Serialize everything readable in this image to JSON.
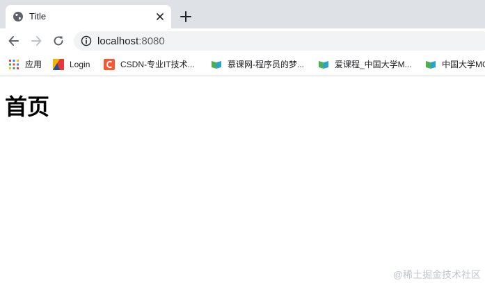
{
  "tab": {
    "title": "Title"
  },
  "address_bar": {
    "host": "localhost",
    "port": ":8080"
  },
  "bookmarks": [
    {
      "label": "应用",
      "icon": "apps-grid-icon"
    },
    {
      "label": "Login",
      "icon": "login-favicon-icon"
    },
    {
      "label": "CSDN-专业IT技术...",
      "icon": "csdn-favicon-icon"
    },
    {
      "label": "慕课网-程序员的梦...",
      "icon": "book-favicon-icon"
    },
    {
      "label": "爱课程_中国大学M...",
      "icon": "book-favicon-icon"
    },
    {
      "label": "中国大学MOOC",
      "icon": "book-favicon-icon"
    }
  ],
  "page": {
    "heading": "首页"
  },
  "watermark": "@稀土掘金技术社区",
  "colors": {
    "tabstrip_bg": "#dee1e6",
    "omnibox_bg": "#f1f3f4",
    "icon_gray": "#5f6368",
    "csdn_red": "#fc5531"
  }
}
